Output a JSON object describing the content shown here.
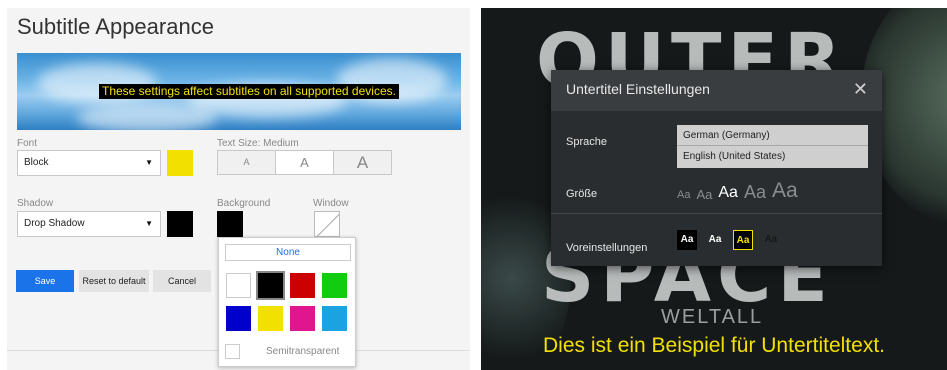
{
  "left": {
    "title": "Subtitle Appearance",
    "preview_text": "These settings affect subtitles on all supported devices.",
    "font": {
      "label": "Font",
      "value": "Block",
      "color": "#f2e000"
    },
    "text_size": {
      "label": "Text Size: Medium",
      "options": [
        "A",
        "A",
        "A"
      ],
      "selected": 1
    },
    "shadow": {
      "label": "Shadow",
      "value": "Drop Shadow",
      "color": "#000000"
    },
    "background": {
      "label": "Background",
      "color": "#000000"
    },
    "window": {
      "label": "Window"
    },
    "buttons": {
      "save": "Save",
      "reset": "Reset to default",
      "cancel": "Cancel"
    },
    "color_popup": {
      "none_label": "None",
      "colors": [
        "#ffffff",
        "#000000",
        "#cc0000",
        "#11cc11",
        "#0000cc",
        "#f2e000",
        "#e0168f",
        "#1aa3e0"
      ],
      "selected": 1,
      "semitransparent_label": "Semitransparent"
    }
  },
  "right": {
    "background_letters": [
      "OUTER",
      "SPACE"
    ],
    "background_subtext": "WELTALL",
    "dialog": {
      "title": "Untertitel Einstellungen",
      "close_glyph": "✕",
      "language_label": "Sprache",
      "languages": [
        "German (Germany)",
        "English (United States)"
      ],
      "size_label": "Größe",
      "sizes": [
        "Aa",
        "Aa",
        "Aa",
        "Aa",
        "Aa"
      ],
      "selected_size": 2,
      "presets_label": "Voreinstellungen",
      "presets": [
        "Aa",
        "Aa",
        "Aa",
        "Aa"
      ],
      "selected_preset": 2
    },
    "subtitle_text": "Dies ist ein Beispiel für Untertiteltext."
  }
}
